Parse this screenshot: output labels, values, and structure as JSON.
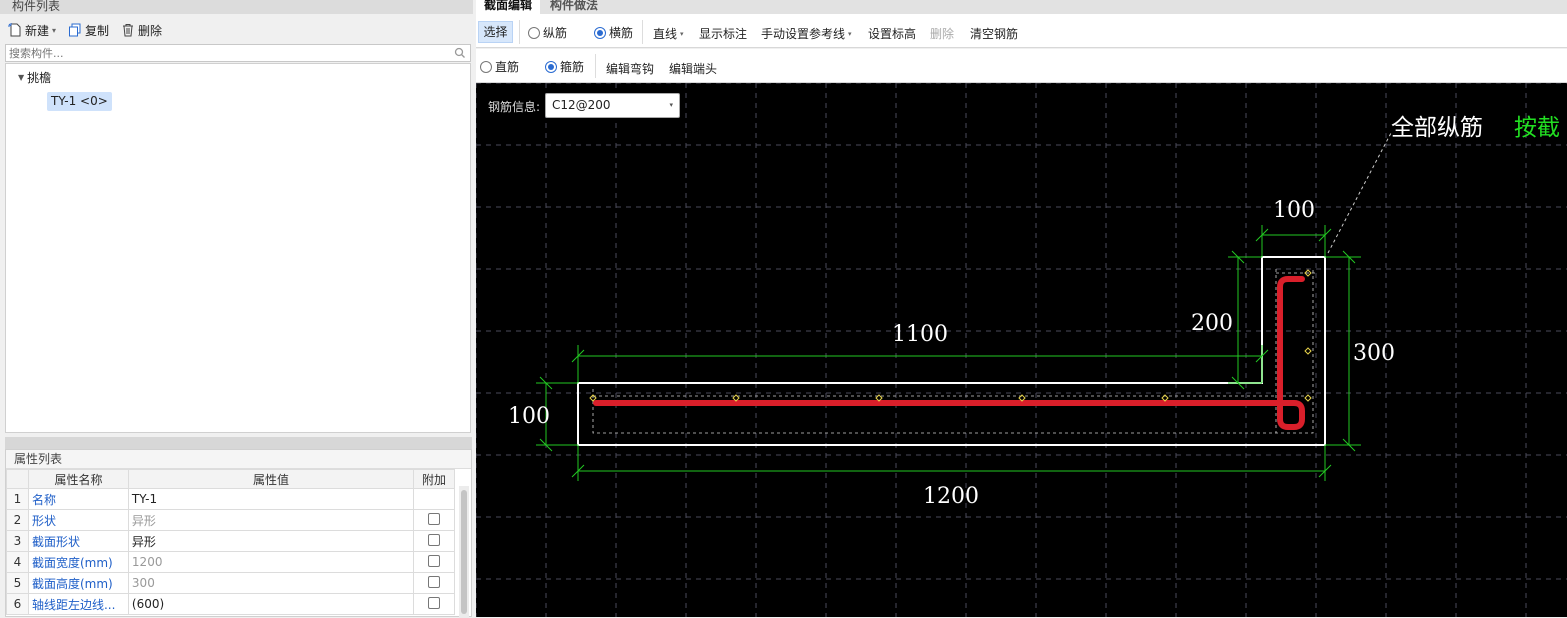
{
  "left_panel": {
    "component_list_title": "构件列表",
    "toolbar": {
      "new_label": "新建",
      "copy_label": "复制",
      "delete_label": "删除"
    },
    "search_placeholder": "搜索构件...",
    "tree": {
      "group_label": "挑檐",
      "item_label": "TY-1 <0>"
    },
    "property_list_title": "属性列表",
    "table": {
      "headers": [
        "属性名称",
        "属性值",
        "附加"
      ],
      "rows": [
        {
          "index": "1",
          "name": "名称",
          "value": "TY-1",
          "value_grey": false,
          "has_checkbox": false
        },
        {
          "index": "2",
          "name": "形状",
          "value": "异形",
          "value_grey": true,
          "has_checkbox": true
        },
        {
          "index": "3",
          "name": "截面形状",
          "value": "异形",
          "value_grey": false,
          "has_checkbox": true
        },
        {
          "index": "4",
          "name": "截面宽度(mm)",
          "value": "1200",
          "value_grey": true,
          "has_checkbox": true
        },
        {
          "index": "5",
          "name": "截面高度(mm)",
          "value": "300",
          "value_grey": true,
          "has_checkbox": true
        },
        {
          "index": "6",
          "name": "轴线距左边线...",
          "value": "(600)",
          "value_grey": false,
          "has_checkbox": true
        }
      ]
    }
  },
  "right_panel": {
    "tabs": [
      "截面编辑",
      "构件做法"
    ],
    "toolbar1": {
      "select": "选择",
      "longitudinal": "纵筋",
      "transverse": "横筋",
      "line": "直线",
      "show_dims": "显示标注",
      "manual_ref": "手动设置参考线",
      "set_elev": "设置标高",
      "delete": "删除",
      "clear_rebar": "清空钢筋"
    },
    "toolbar2": {
      "straight": "直筋",
      "stirrup": "箍筋",
      "edit_hook": "编辑弯钩",
      "edit_end": "编辑端头"
    },
    "canvas": {
      "rebar_info_label": "钢筋信息:",
      "rebar_info_value": "C12@200",
      "annotation_all_long": "全部纵筋",
      "annotation_by_section": "按截",
      "dims": {
        "top_width": "100",
        "vertical_left": "200",
        "right_height": "300",
        "slab_length": "1100",
        "slab_thickness": "100",
        "total_width": "1200"
      },
      "colors": {
        "background": "#000000",
        "outline": "#ffffff",
        "rebar": "#d91f2a",
        "dim": "#22c822",
        "grid": "#4a4a5a"
      }
    }
  }
}
